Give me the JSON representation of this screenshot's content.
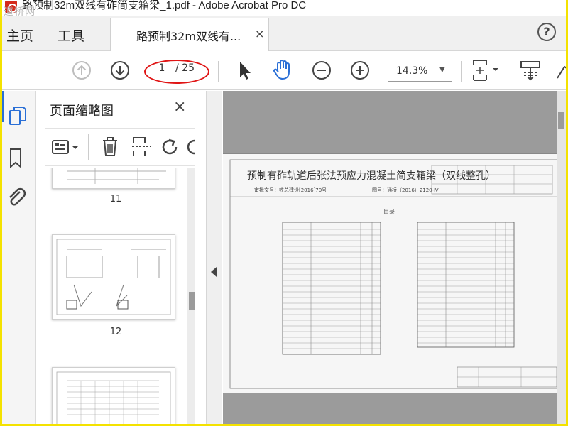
{
  "window": {
    "title": "路预制32m双线有砟简支箱梁_1.pdf - Adobe Acrobat Pro DC",
    "watermark": "道桥网"
  },
  "tabs": {
    "home": "主页",
    "tools": "工具",
    "document": "路预制32m双线有...",
    "close": "×",
    "help": "?"
  },
  "toolbar": {
    "page_current": "1",
    "page_total": "/ 25",
    "zoom": "14.3%",
    "icons": [
      "arrow-up-circle-icon",
      "arrow-down-circle-icon",
      "select-cursor-icon",
      "hand-tool-icon",
      "zoom-out-icon",
      "zoom-in-icon",
      "fit-page-icon",
      "scroll-mode-icon",
      "highlight-icon"
    ],
    "annotation_color": "#e01515"
  },
  "rail": {
    "icons": [
      "page-thumbnails-icon",
      "bookmark-icon",
      "attachment-icon"
    ]
  },
  "thumbnails_panel": {
    "title": "页面缩略图",
    "close": "×",
    "tools": [
      "thumbnail-options-icon",
      "delete-icon",
      "insert-page-icon",
      "rotate-icon"
    ],
    "pages": [
      {
        "label": "11"
      },
      {
        "label": "12"
      },
      {
        "label": ""
      }
    ]
  },
  "document": {
    "title": "预制有砟轨道后张法预应力混凝土简支箱梁（双线整孔）",
    "approval": "审批文号：铁总建设[2016]70号",
    "drawing_no": "图号：通桥（2016）2120-Ⅳ",
    "toc_heading": "目录"
  },
  "colors": {
    "accent": "#2a6fd6",
    "app_red": "#d42a1b",
    "frame": "#f4e200"
  }
}
